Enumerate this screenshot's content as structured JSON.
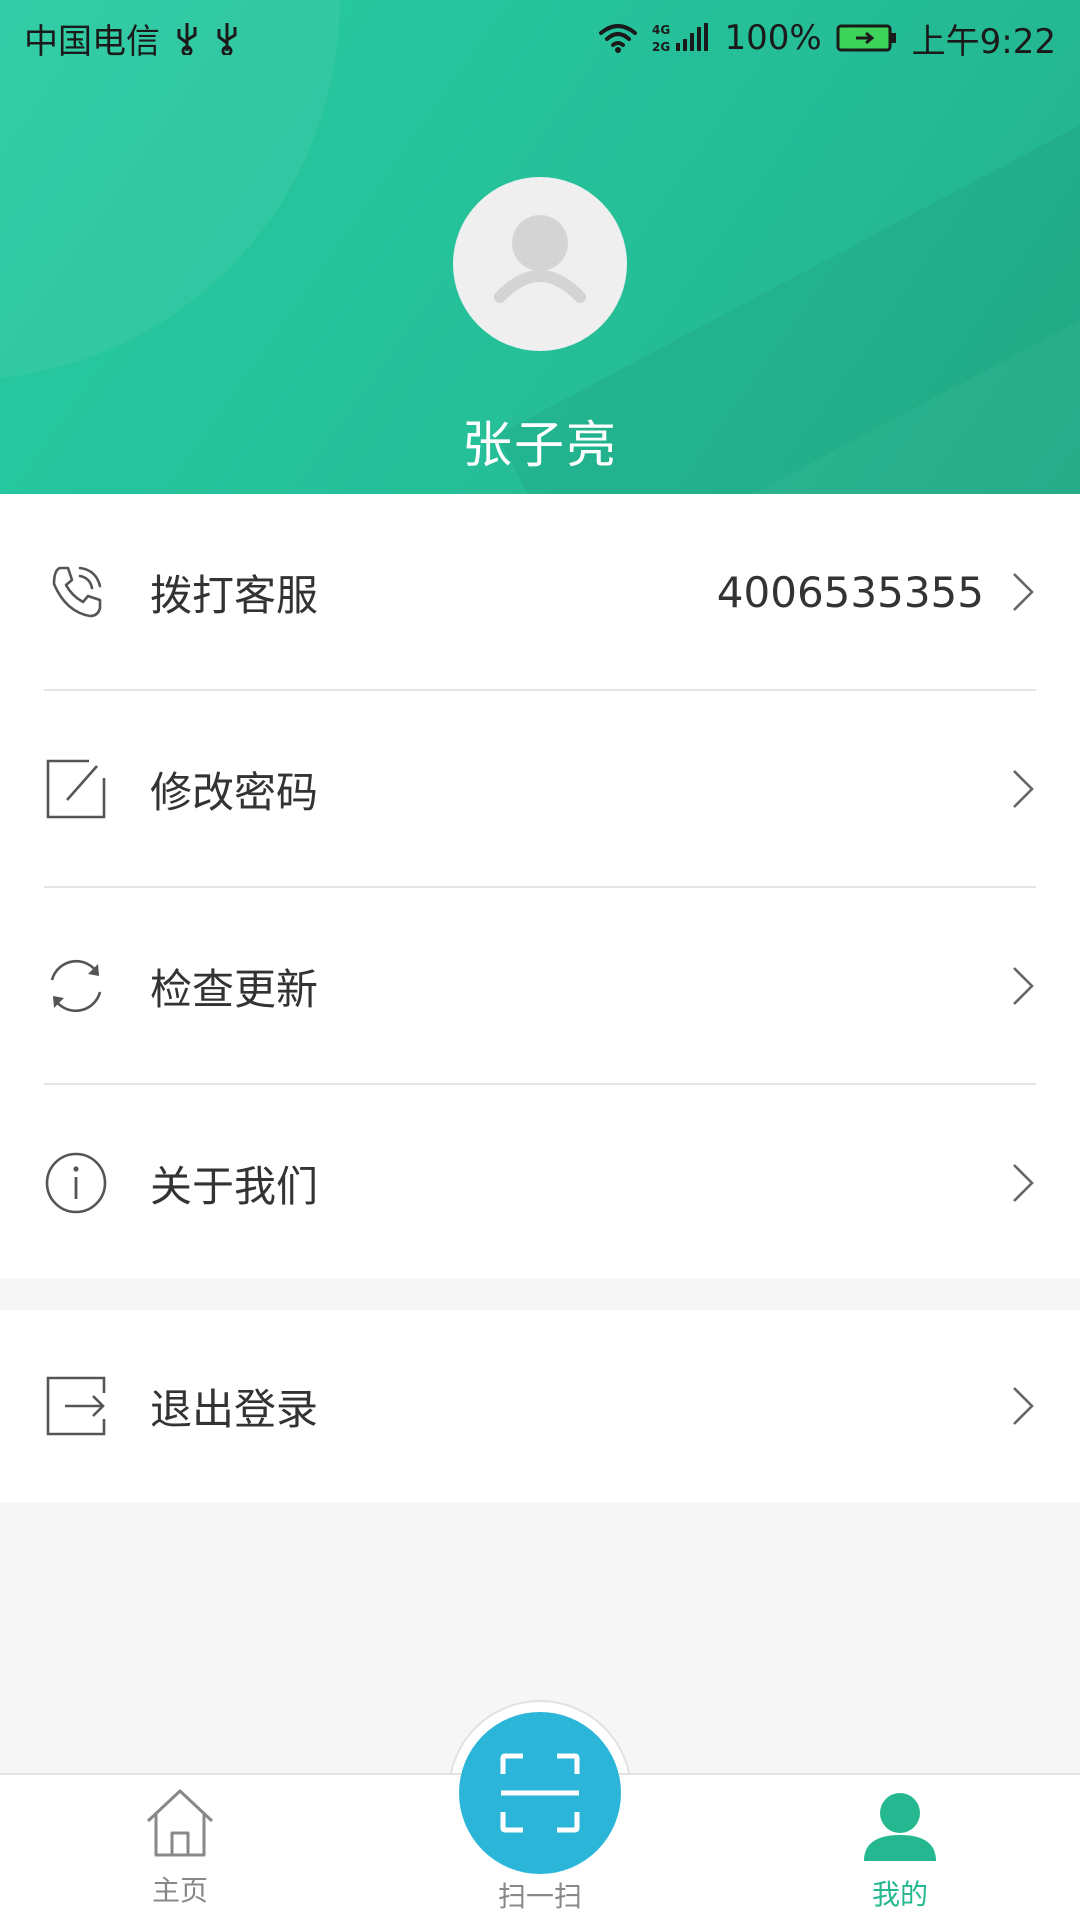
{
  "status_bar": {
    "carrier": "中国电信",
    "network": "4G 2G",
    "battery": "100%",
    "time": "上午9:22",
    "icons": [
      "usb-icon",
      "usb-icon",
      "wifi-icon",
      "signal-icon",
      "battery-charging-icon"
    ]
  },
  "profile": {
    "avatar_icon": "default-user-avatar-icon",
    "name": "张子亮"
  },
  "menu": {
    "items": [
      {
        "icon": "phone-icon",
        "label": "拨打客服",
        "value": "4006535355"
      },
      {
        "icon": "edit-icon",
        "label": "修改密码"
      },
      {
        "icon": "refresh-icon",
        "label": "检查更新"
      },
      {
        "icon": "info-icon",
        "label": "关于我们"
      }
    ],
    "logout": {
      "icon": "logout-icon",
      "label": "退出登录"
    }
  },
  "tabbar": {
    "home_label": "主页",
    "scan_label": "扫一扫",
    "mine_label": "我的",
    "active": "mine"
  },
  "colors": {
    "header": "#26c49c",
    "accent": "#25b890",
    "scan_button": "#2bb5d8",
    "background": "#f6f6f6"
  }
}
